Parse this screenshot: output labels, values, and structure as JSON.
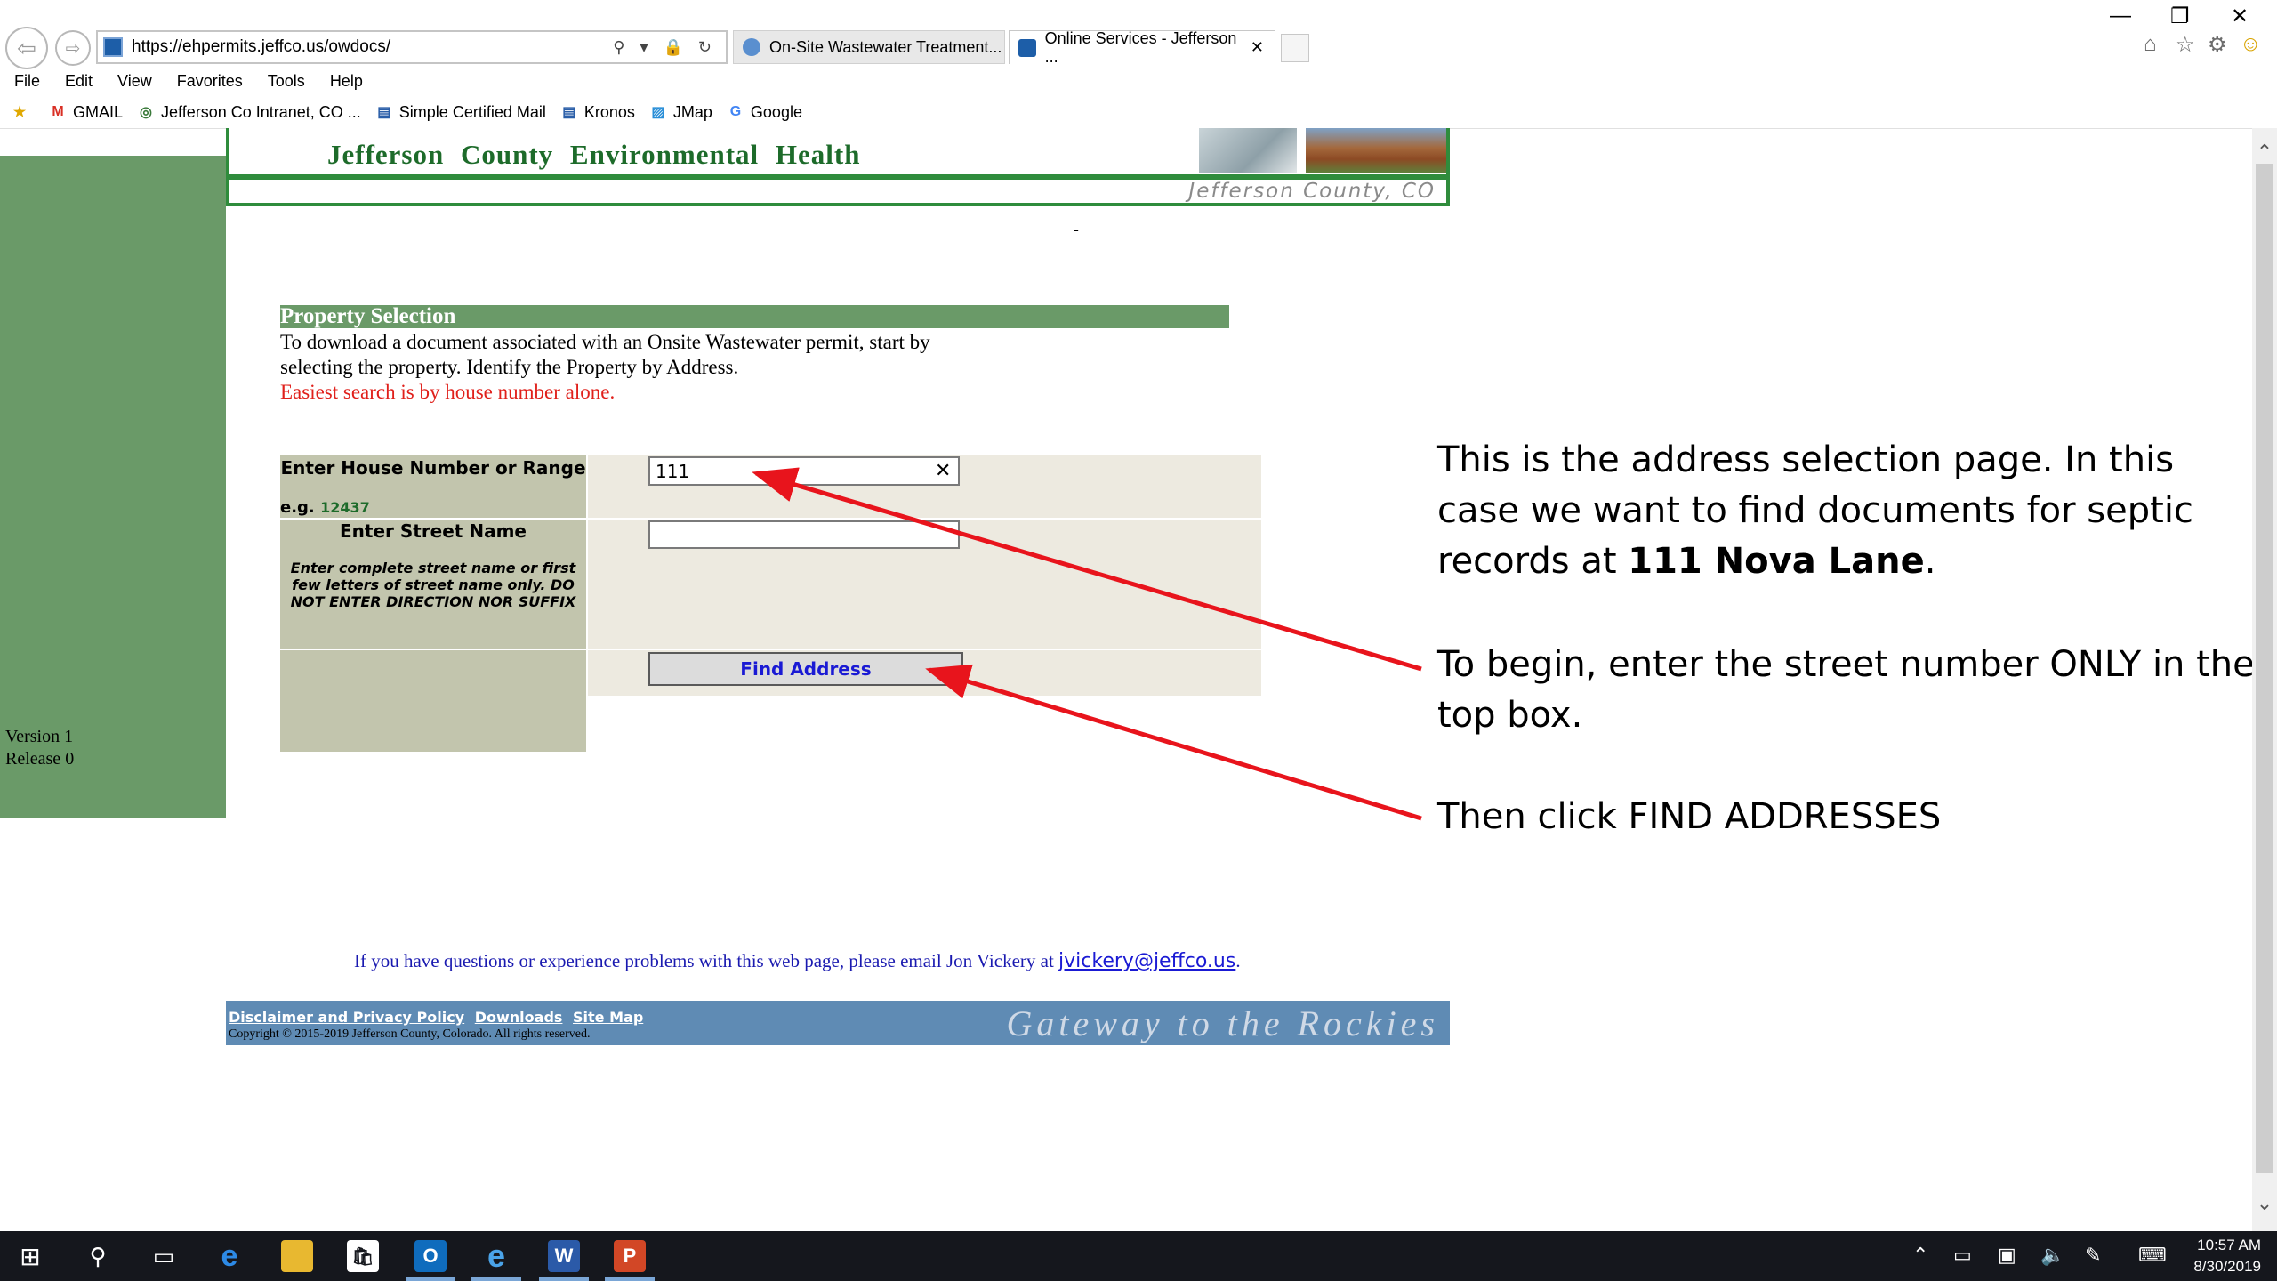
{
  "browser": {
    "url_prefix": "https://ehpermits.",
    "url_domain": "jeffco.us",
    "url_path": "/owdocs/",
    "url_icons": "⚲ ▾ 🔒 ↻",
    "tabs": [
      {
        "label": "On-Site Wastewater Treatment..."
      },
      {
        "label": "Online Services - Jefferson ...",
        "close": "✕"
      }
    ],
    "window_controls": {
      "minimize": "—",
      "restore": "❐",
      "close": "✕"
    },
    "right_tools": [
      "⌂",
      "☆",
      "⚙",
      "☺"
    ]
  },
  "menubar": [
    "File",
    "Edit",
    "View",
    "Favorites",
    "Tools",
    "Help"
  ],
  "favorites": [
    {
      "label": "GMAIL",
      "icon": "M"
    },
    {
      "label": "Jefferson Co Intranet, CO ...",
      "icon": "◎"
    },
    {
      "label": "Simple Certified Mail",
      "icon": "▤"
    },
    {
      "label": "Kronos",
      "icon": "▤"
    },
    {
      "label": "JMap",
      "icon": "▨"
    },
    {
      "label": "Google",
      "icon": "G"
    }
  ],
  "page": {
    "banner_title": "Jefferson County Environmental Health",
    "banner_subtitle": "Jefferson County, CO",
    "dash": "-",
    "version": "Version 1",
    "release": "Release 0",
    "section_title": "Property Selection",
    "intro_line1": "To download a document associated with an Onsite Wastewater permit, start by",
    "intro_line2": "selecting the property.   Identify the Property by Address.",
    "tip": "Easiest search is by house number alone.",
    "house_label": "Enter House Number or Range",
    "eg_prefix": "e.g.",
    "eg_value": "12437",
    "house_value": "111",
    "house_clear": "✕",
    "street_label": "Enter Street Name",
    "street_help": "Enter complete street name or first few letters of street name only. DO NOT ENTER DIRECTION NOR SUFFIX",
    "street_value": "",
    "find_button": "Find Address",
    "contact_text": "If you have questions or experience problems with this web page, please email Jon Vickery at",
    "contact_email": "jvickery@jeffco.us",
    "contact_period": ".",
    "footer_links": [
      "Disclaimer and Privacy Policy",
      "Downloads",
      "Site Map"
    ],
    "footer_copyright": "Copyright © 2015-2019   Jefferson County, Colorado. All rights reserved.",
    "footer_slogan": "Gateway to the Rockies"
  },
  "annotations": {
    "note1_a": "This is the address selection page. In this case we want to find documents for septic records at ",
    "note1_bold": "111 Nova Lane",
    "note1_end": ".",
    "note2": "To begin, enter the street number ONLY in the top box.",
    "note3": "Then click FIND ADDRESSES",
    "arrow_color": "#e8141c"
  },
  "taskbar": {
    "time": "10:57 AM",
    "date": "8/30/2019"
  }
}
